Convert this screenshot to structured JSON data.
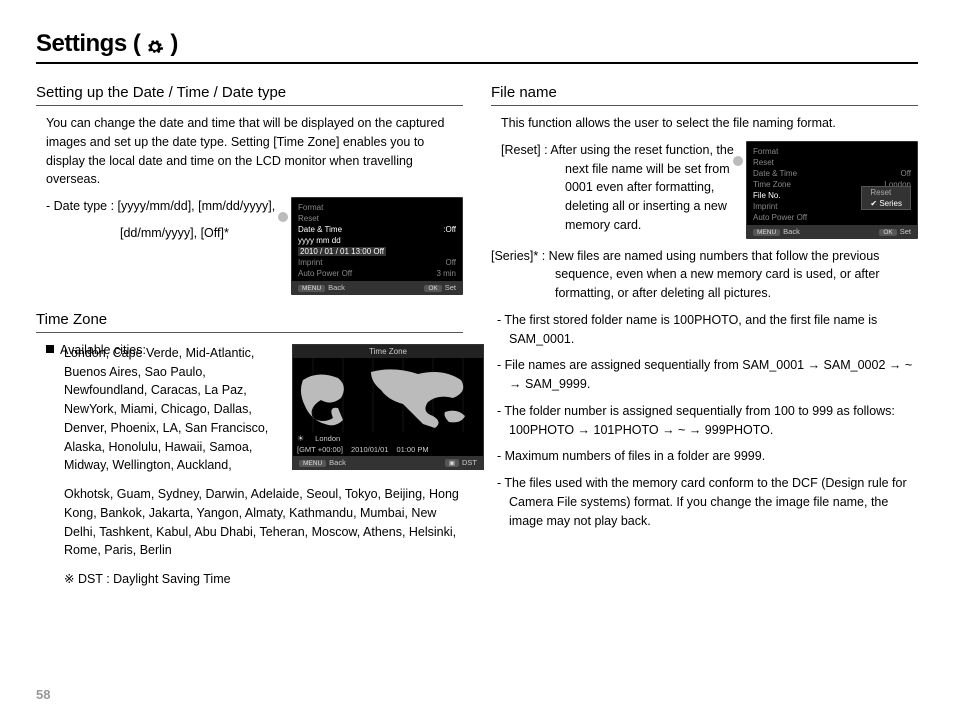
{
  "page_number": "58",
  "title_prefix": "Settings ( ",
  "title_suffix": " )",
  "left": {
    "h_datetime": "Setting up the Date / Time / Date type",
    "datetime_para": "You can change the date and time that will be displayed on the captured images and set up the date type. Setting [Time Zone] enables you to display the local date and time on the LCD monitor when travelling overseas.",
    "datetype_line1": "- Date type : [yyyy/mm/dd], [mm/dd/yyyy],",
    "datetype_line2": "[dd/mm/yyyy], [Off]*",
    "h_timezone": "Time Zone",
    "tz_label": "Available cities:",
    "tz_cities": "London, Cape Verde, Mid-Atlantic, Buenos Aires, Sao Paulo, Newfoundland, Caracas, La Paz, NewYork, Miami, Chicago, Dallas, Denver, Phoenix, LA, San Francisco, Alaska, Honolulu, Hawaii, Samoa, Midway, Wellington, Auckland, Okhotsk, Guam, Sydney, Darwin, Adelaide, Seoul, Tokyo, Beijing, Hong Kong, Bankok, Jakarta, Yangon, Almaty, Kathmandu, Mumbai, New Delhi, Tashkent, Kabul, Abu Dhabi, Teheran, Moscow, Athens, Helsinki, Rome, Paris, Berlin",
    "dst_note": "※ DST : Daylight Saving Time"
  },
  "right": {
    "h_filename": "File name",
    "filename_para": "This function allows the user to select the file naming format.",
    "reset_label": "[Reset]  :",
    "reset_text": "After using the reset function, the next file name will be set from 0001 even after formatting, deleting all or inserting a new memory card.",
    "series_label": "[Series]* :",
    "series_text": "New files are named using numbers that follow the previous sequence, even when a new memory card is used, or after formatting, or after deleting all pictures.",
    "n1": "- The first stored folder name is 100PHOTO, and the first file name is SAM_0001.",
    "n2": "- File names are assigned sequentially from SAM_0001 → SAM_0002 → ~ → SAM_9999.",
    "n3": "- The folder number is assigned sequentially from 100 to 999 as follows: 100PHOTO → 101PHOTO → ~ → 999PHOTO.",
    "n4": "- Maximum numbers of files in a folder are 9999.",
    "n5": "- The files used with the memory card conform to the DCF (Design rule for Camera File systems) format. If you change the image file name, the image may not play back."
  },
  "panel_dt": {
    "items": {
      "format": "Format",
      "reset": "Reset",
      "datetime_k": "Date & Time",
      "datetime_v": ":Off",
      "datetype_k": "yyyy  mm  dd",
      "datetype_v": "",
      "datevals": "2010 / 01 / 01    13:00    Off",
      "imprint_k": "Imprint",
      "imprint_v": "Off",
      "apo_k": "Auto Power Off",
      "apo_v": "3 min"
    },
    "foot_back": "Back",
    "foot_set": "Set",
    "menu_btn": "MENU",
    "ok_btn": "OK"
  },
  "panel_fn": {
    "items": {
      "format": "Format",
      "reset": "Reset",
      "dt_k": "Date & Time",
      "dt_v": "Off",
      "tz_k": "Time Zone",
      "tz_v": "London",
      "fno_k": "File No.",
      "imprint": "Imprint",
      "apo": "Auto Power Off"
    },
    "popup_reset": "Reset",
    "popup_series": "Series",
    "foot_back": "Back",
    "foot_set": "Set",
    "menu_btn": "MENU",
    "ok_btn": "OK"
  },
  "panel_map": {
    "title": "Time Zone",
    "city": "London",
    "gmt": "[GMT +00:00]",
    "date": "2010/01/01",
    "time": "01:00 PM",
    "foot_back": "Back",
    "foot_dst": "DST",
    "menu_btn": "MENU"
  }
}
